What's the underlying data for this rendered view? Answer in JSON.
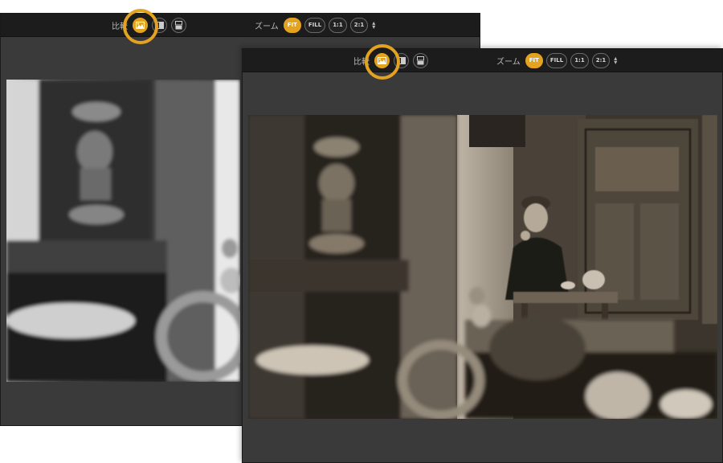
{
  "toolbar": {
    "compare_label": "比較",
    "zoom_label": "ズーム",
    "zoom_options": [
      "FIT",
      "FILL",
      "1:1",
      "2:1"
    ],
    "active_zoom": "FIT",
    "view_modes": [
      "single-view-icon",
      "split-view-icon",
      "side-by-side-icon"
    ],
    "active_view_mode": "single-view-icon"
  },
  "colors": {
    "accent": "#e3a321",
    "toolbar_bg": "#1c1c1c",
    "panel_bg": "#3a3a3a"
  }
}
